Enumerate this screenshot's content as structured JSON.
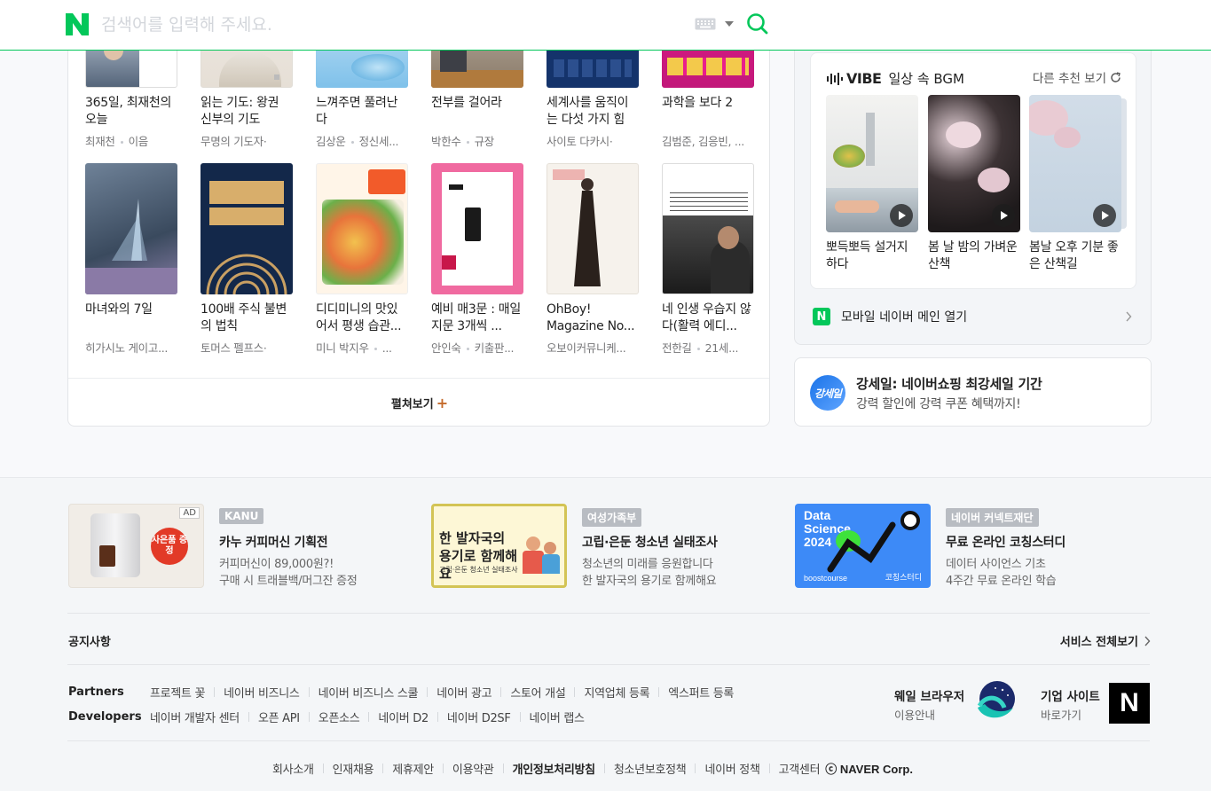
{
  "search": {
    "placeholder": "검색어를 입력해 주세요."
  },
  "books": {
    "row1": [
      {
        "title": "365일, 최재천의 오늘",
        "author": "최재천",
        "publisher": "이음"
      },
      {
        "title": "읽는 기도: 왕권 신부의 기도",
        "author": "무명의 기도자",
        "publisher": "·"
      },
      {
        "title": "느껴주면 풀려난다",
        "author": "김상운",
        "publisher": "정신세..."
      },
      {
        "title": "전부를 걸어라",
        "author": "박한수",
        "publisher": "규장"
      },
      {
        "title": "세계사를 움직이는 다섯 가지 힘",
        "author": "사이토 다카시",
        "publisher": "·"
      },
      {
        "title": "과학을 보다 2",
        "author": "김범준, 김응빈, ...",
        "publisher": ""
      }
    ],
    "row2": [
      {
        "title": "마녀와의 7일",
        "author": "히가시노 게이고...",
        "publisher": ""
      },
      {
        "title": "100배 주식 불변의 법칙",
        "author": "토머스 펠프스",
        "publisher": "·"
      },
      {
        "title": "디디미니의 맛있어서 평생 습관...",
        "author": "미니 박지우",
        "publisher": "..."
      },
      {
        "title": "예비 매3문 : 매일 지문 3개씩 ...",
        "author": "안인숙",
        "publisher": "키출판..."
      },
      {
        "title": "OhBoy! Magazine No...",
        "author": "오보이커뮤니케...",
        "publisher": ""
      },
      {
        "title": "네 인생 우습지 않다(활력 에디...",
        "author": "전한길",
        "publisher": "21세..."
      }
    ],
    "more_label": "펼쳐보기"
  },
  "vibe": {
    "logo": "VIBE",
    "subtitle": "일상 속 BGM",
    "other_label": "다른 추천 보기",
    "items": [
      {
        "title": "뽀득뽀득 설거지하다"
      },
      {
        "title": "봄 날 밤의 가벼운 산책"
      },
      {
        "title": "봄날 오후 기분 좋은 산책길"
      }
    ]
  },
  "mobile_link": {
    "badge": "N",
    "label": "모바일 네이버 메인 열기"
  },
  "promo": {
    "badge": "강세일",
    "title": "강세일: 네이버쇼핑 최강세일 기간",
    "subtitle": "강력 할인에 강력 쿠폰 혜택까지!"
  },
  "ads": [
    {
      "badge": "AD",
      "sticker": "사은품 증정",
      "tag": "KANU",
      "title": "카누 커피머신 기획전",
      "line1": "커피머신이 89,000원?!",
      "line2": "구매 시 트래블백/머그잔 증정"
    },
    {
      "banner": "한 발자국의 용기로 함께해요",
      "banner_sub": "고립·은둔 청소년 실태조사",
      "tag": "여성가족부",
      "title": "고립·은둔 청소년 실태조사",
      "line1": "청소년의 미래를 응원합니다",
      "line2": "한 발자국의 용기로 함께해요"
    },
    {
      "banner": "Data Science 2024",
      "banner_l": "boostcourse",
      "banner_r": "코칭스터디",
      "tag": "네이버 커넥트재단",
      "title": "무료 온라인 코칭스터디",
      "line1": "데이터 사이언스 기초",
      "line2": "4주간 무료 온라인 학습"
    }
  ],
  "footer": {
    "notice": "공지사항",
    "service_all": "서비스 전체보기",
    "partners_label": "Partners",
    "partners": [
      "프로젝트 꽃",
      "네이버 비즈니스",
      "네이버 비즈니스 스쿨",
      "네이버 광고",
      "스토어 개설",
      "지역업체 등록",
      "엑스퍼트 등록"
    ],
    "developers_label": "Developers",
    "developers": [
      "네이버 개발자 센터",
      "오픈 API",
      "오픈소스",
      "네이버 D2",
      "네이버 D2SF",
      "네이버 랩스"
    ],
    "whale_title": "웨일 브라우저",
    "whale_sub": "이용안내",
    "corp_title": "기업 사이트",
    "corp_sub": "바로가기",
    "corp_badge": "N",
    "bottom": [
      "회사소개",
      "인재채용",
      "제휴제안",
      "이용약관",
      "개인정보처리방침",
      "청소년보호정책",
      "네이버 정책",
      "고객센터"
    ],
    "copyright": "ⓒ NAVER Corp."
  },
  "colors": {
    "naver_green": "#03c75a",
    "plus_orange": "#c46a2b"
  }
}
